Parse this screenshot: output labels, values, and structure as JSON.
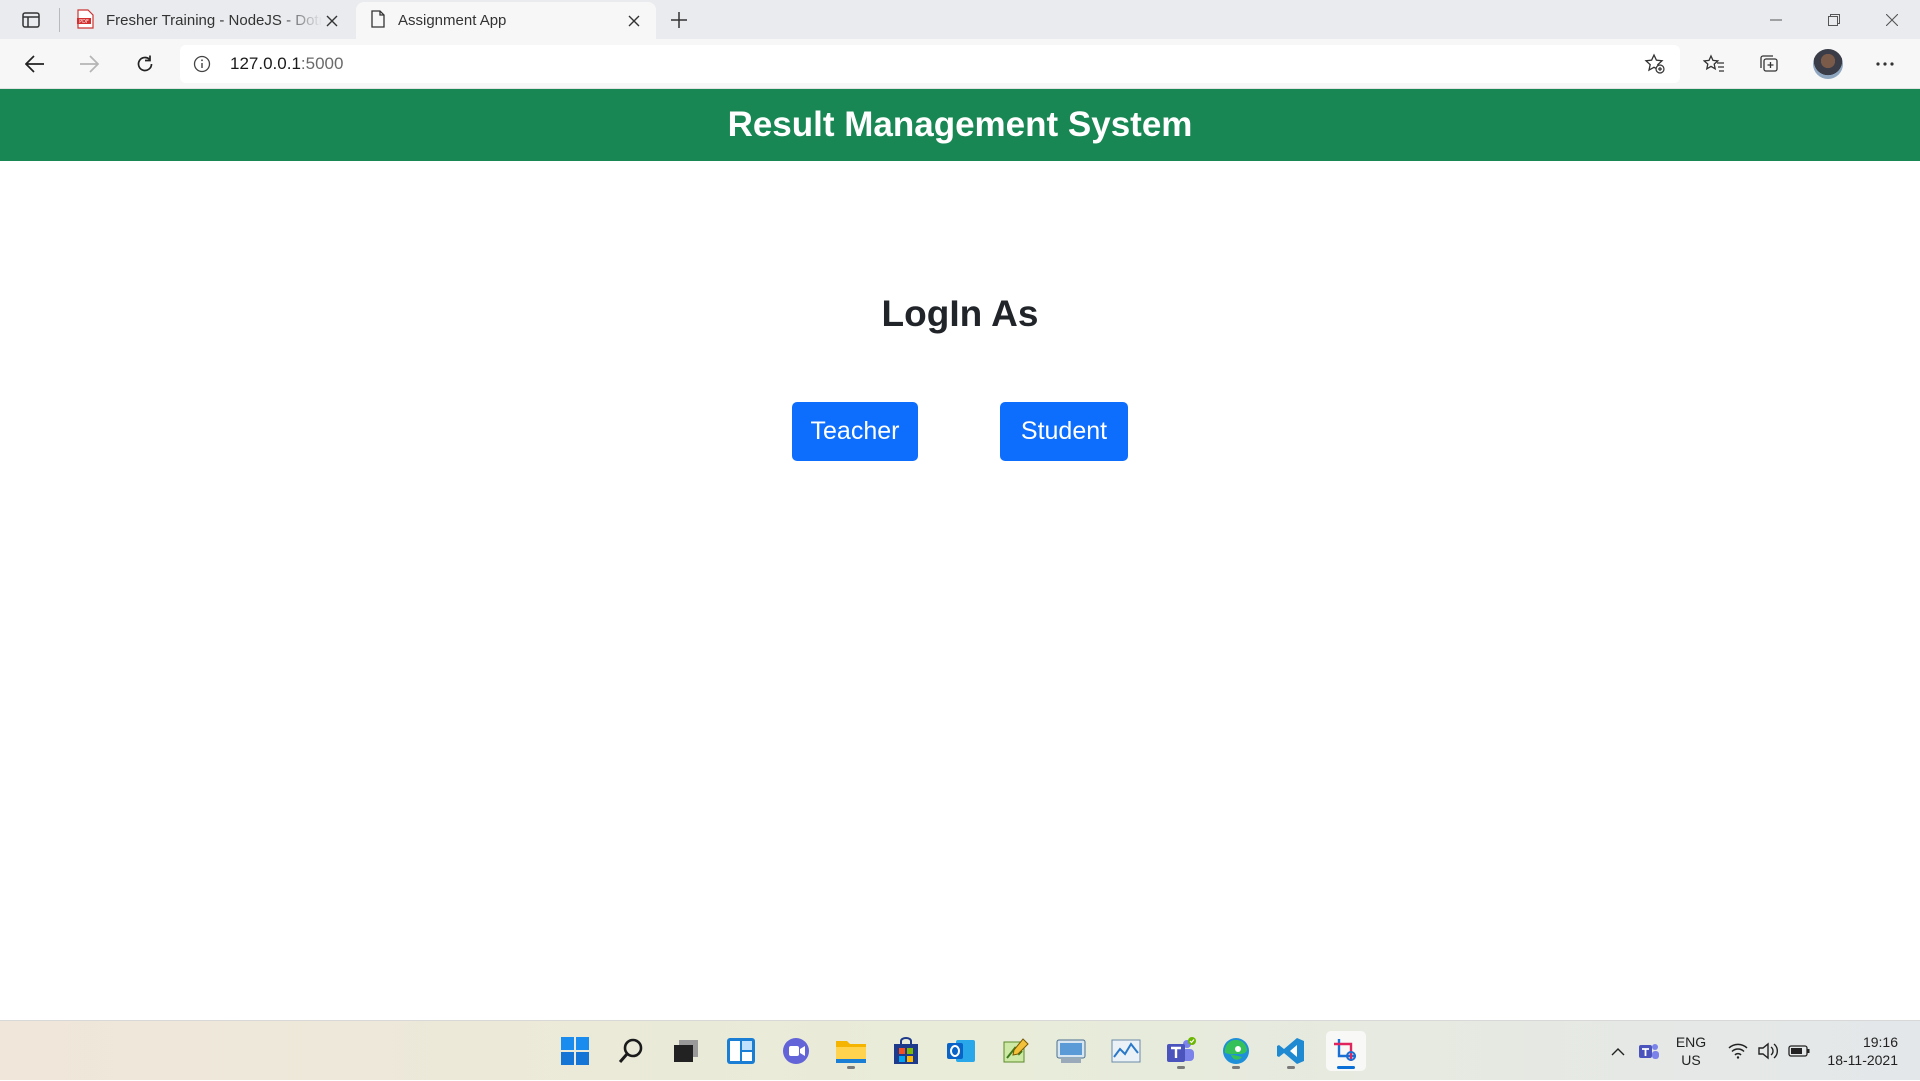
{
  "browser": {
    "tabs": [
      {
        "title": "Fresher Training - NodeJS - Dotn",
        "icon": "pdf-icon",
        "active": false
      },
      {
        "title": "Assignment App",
        "icon": "page-icon",
        "active": true
      }
    ],
    "address": {
      "host": "127.0.0.1",
      "port": ":5000"
    }
  },
  "app": {
    "header_title": "Result Management System",
    "login_heading": "LogIn As",
    "buttons": {
      "teacher": "Teacher",
      "student": "Student"
    },
    "colors": {
      "header_bg": "#198754",
      "button_bg": "#0d6efd"
    }
  },
  "taskbar": {
    "icons": [
      "start-icon",
      "search-icon",
      "task-view-icon",
      "widgets-icon",
      "chat-icon",
      "file-explorer-icon",
      "store-icon",
      "outlook-icon",
      "sticky-notes-icon",
      "remote-desktop-icon",
      "performance-monitor-icon",
      "teams-icon",
      "edge-icon",
      "vscode-icon",
      "snipping-tool-icon"
    ],
    "language": {
      "line1": "ENG",
      "line2": "US"
    },
    "clock": {
      "time": "19:16",
      "date": "18-11-2021"
    }
  }
}
